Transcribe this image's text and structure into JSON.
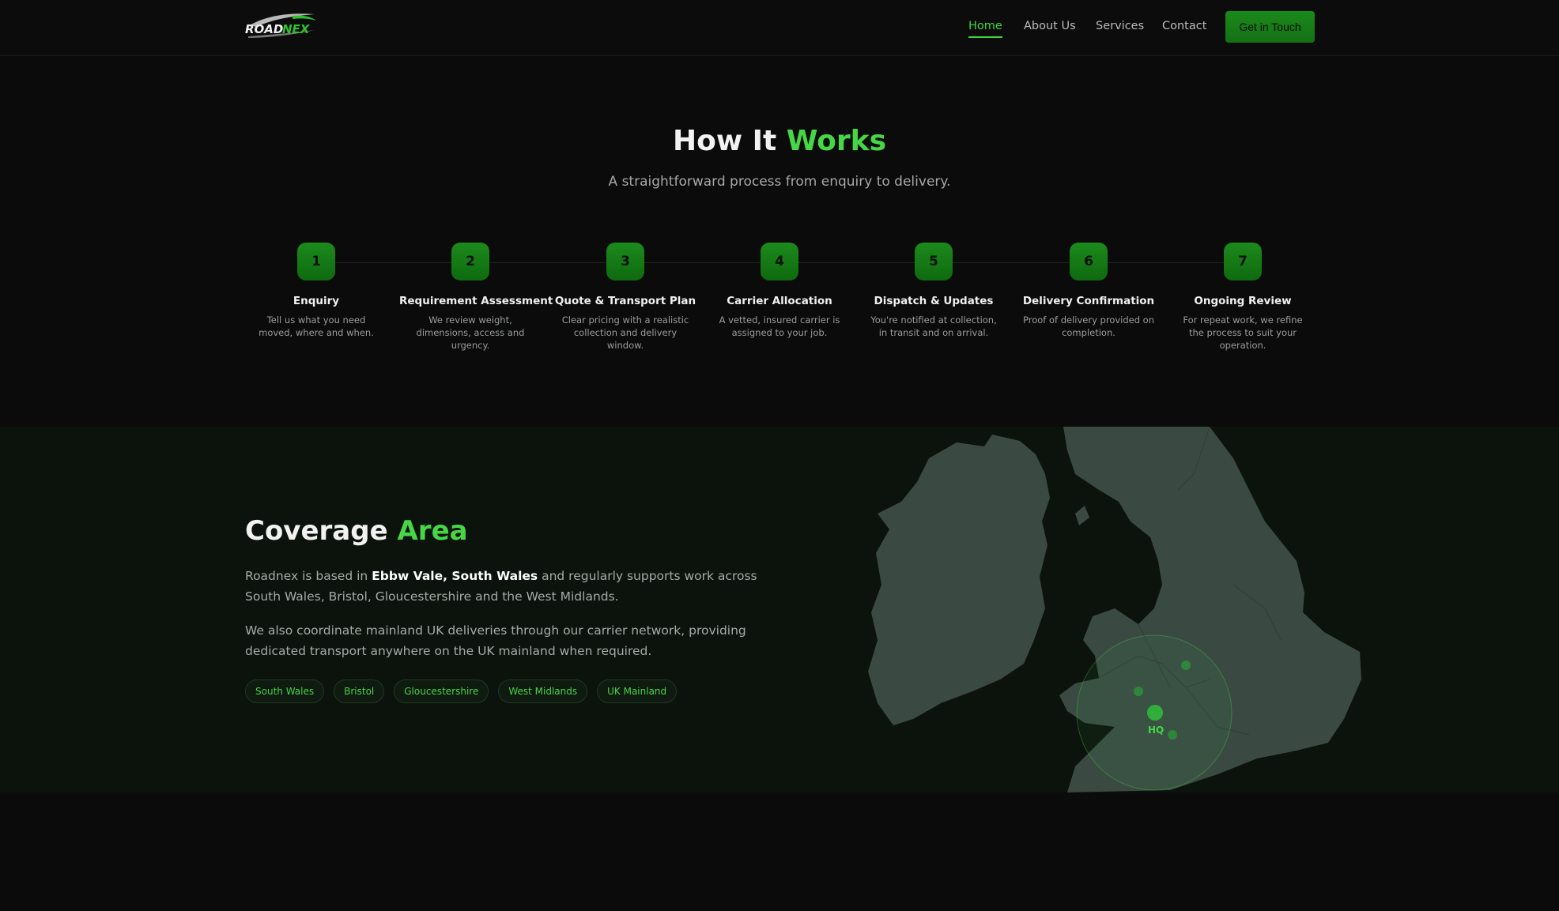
{
  "header": {
    "logo_text": "ROADNEX",
    "nav": [
      {
        "label": "Home",
        "active": true
      },
      {
        "label": "About Us",
        "active": false
      },
      {
        "label": "Services",
        "active": false
      },
      {
        "label": "Contact",
        "active": false
      }
    ],
    "cta_label": "Get in Touch"
  },
  "how_it_works": {
    "title_main": "How It ",
    "title_accent": "Works",
    "subtitle": "A straightforward process from enquiry to delivery.",
    "steps": [
      {
        "number": "1",
        "title": "Enquiry",
        "desc": "Tell us what you need moved, where and when."
      },
      {
        "number": "2",
        "title": "Requirement Assessment",
        "desc": "We review weight, dimensions, access and urgency."
      },
      {
        "number": "3",
        "title": "Quote & Transport Plan",
        "desc": "Clear pricing with a realistic collection and delivery window."
      },
      {
        "number": "4",
        "title": "Carrier Allocation",
        "desc": "A vetted, insured carrier is assigned to your job."
      },
      {
        "number": "5",
        "title": "Dispatch & Updates",
        "desc": "You're notified at collection, in transit and on arrival."
      },
      {
        "number": "6",
        "title": "Delivery Confirmation",
        "desc": "Proof of delivery provided on completion."
      },
      {
        "number": "7",
        "title": "Ongoing Review",
        "desc": "For repeat work, we refine the process to suit your operation."
      }
    ]
  },
  "coverage": {
    "title_main": "Coverage ",
    "title_accent": "Area",
    "p1_before": "Roadnex is based in ",
    "p1_bold": "Ebbw Vale, South Wales",
    "p1_after": " and regularly supports work across South Wales, Bristol, Gloucestershire and the West Midlands.",
    "p2": "We also coordinate mainland UK deliveries through our carrier network, providing dedicated transport anywhere on the UK mainland when required.",
    "tags": [
      "South Wales",
      "Bristol",
      "Gloucestershire",
      "West Midlands",
      "UK Mainland"
    ],
    "map_hq_label": "HQ"
  },
  "colors": {
    "accent": "#46d646",
    "button_green": "#1b8a1b",
    "background": "#0a0b0a",
    "map_land": "#3a4a43"
  }
}
